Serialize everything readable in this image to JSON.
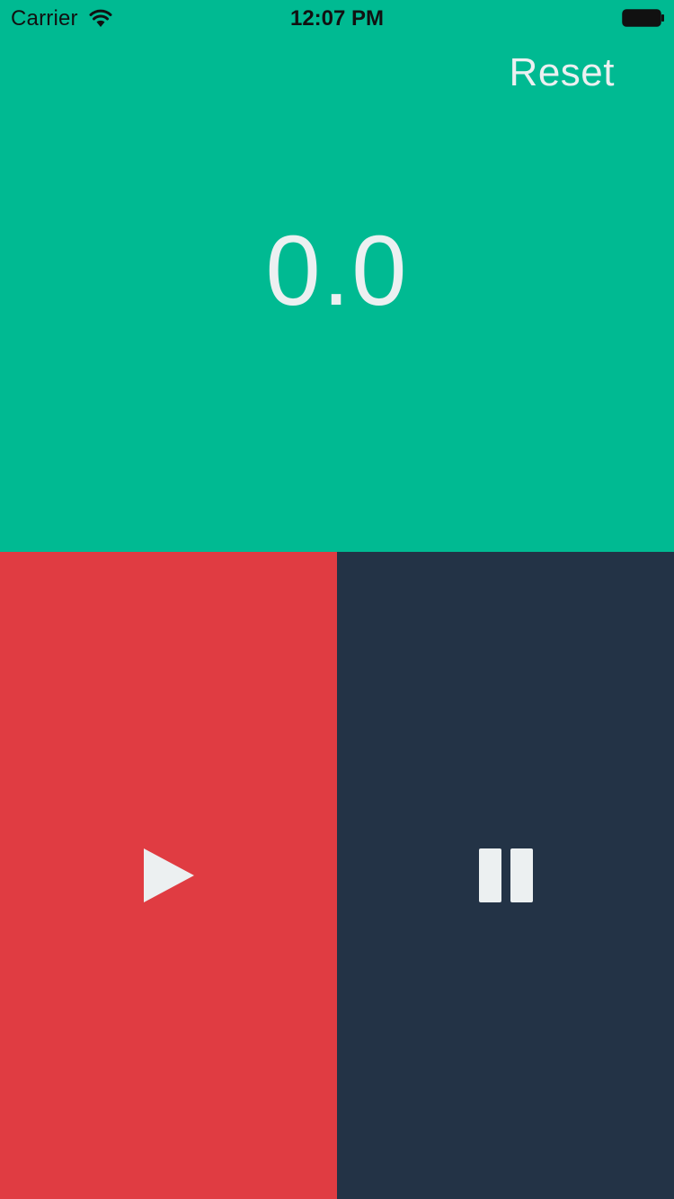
{
  "status_bar": {
    "carrier": "Carrier",
    "time": "12:07 PM",
    "wifi_icon": "wifi-icon",
    "battery_icon": "battery-icon"
  },
  "header": {
    "reset_label": "Reset"
  },
  "timer": {
    "display": "0.0"
  },
  "controls": {
    "start_icon": "play-icon",
    "pause_icon": "pause-icon"
  },
  "colors": {
    "top_panel": "#00ba92",
    "start_panel": "#e03c42",
    "pause_panel": "#233346",
    "foreground": "#ecf0f1"
  }
}
